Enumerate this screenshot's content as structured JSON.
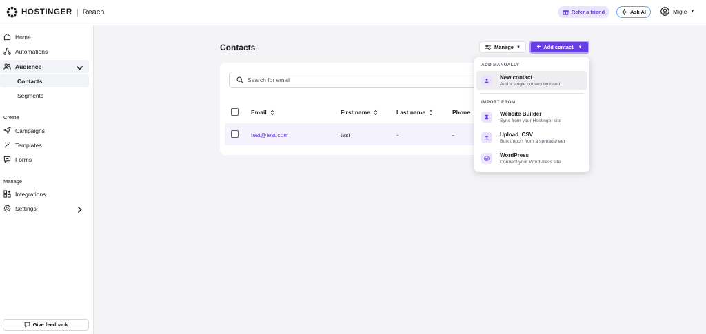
{
  "header": {
    "brand": "HOSTINGER",
    "separator": "|",
    "product": "Reach",
    "refer_label": "Refer a friend",
    "ask_ai_label": "Ask AI",
    "user_name": "Miglė"
  },
  "sidebar": {
    "items": [
      {
        "label": "Home",
        "icon": "home-icon"
      },
      {
        "label": "Automations",
        "icon": "automations-icon"
      },
      {
        "label": "Audience",
        "icon": "audience-icon"
      },
      {
        "label": "Contacts"
      },
      {
        "label": "Segments"
      },
      {
        "label": "Campaigns",
        "icon": "send-icon"
      },
      {
        "label": "Templates",
        "icon": "templates-icon"
      },
      {
        "label": "Forms",
        "icon": "forms-icon"
      },
      {
        "label": "Integrations",
        "icon": "integrations-icon"
      },
      {
        "label": "Settings",
        "icon": "gear-icon"
      }
    ],
    "section_create": "Create",
    "section_manage": "Manage",
    "feedback_label": "Give feedback"
  },
  "main": {
    "title": "Contacts",
    "manage_label": "Manage",
    "add_contact_label": "Add contact",
    "search_placeholder": "Search for email",
    "columns": [
      "Email",
      "First name",
      "Last name",
      "Phone"
    ],
    "rows": [
      {
        "email": "test@test.com",
        "first_name": "test",
        "last_name": "-",
        "phone": "-"
      }
    ]
  },
  "dropdown": {
    "section_manual": "ADD MANUALLY",
    "section_import": "IMPORT FROM",
    "items": [
      {
        "title": "New contact",
        "desc": "Add a single contact by hand",
        "icon": "person-icon"
      },
      {
        "title": "Website Builder",
        "desc": "Sync from your Hostinger site",
        "icon": "website-builder-icon"
      },
      {
        "title": "Upload .CSV",
        "desc": "Bulk import from a spreadsheet",
        "icon": "upload-icon"
      },
      {
        "title": "WordPress",
        "desc": "Connect your WordPress site",
        "icon": "wordpress-icon"
      }
    ]
  },
  "colors": {
    "accent": "#673de6",
    "accent_light": "#ebe4ff",
    "background": "#f4f4f7"
  }
}
